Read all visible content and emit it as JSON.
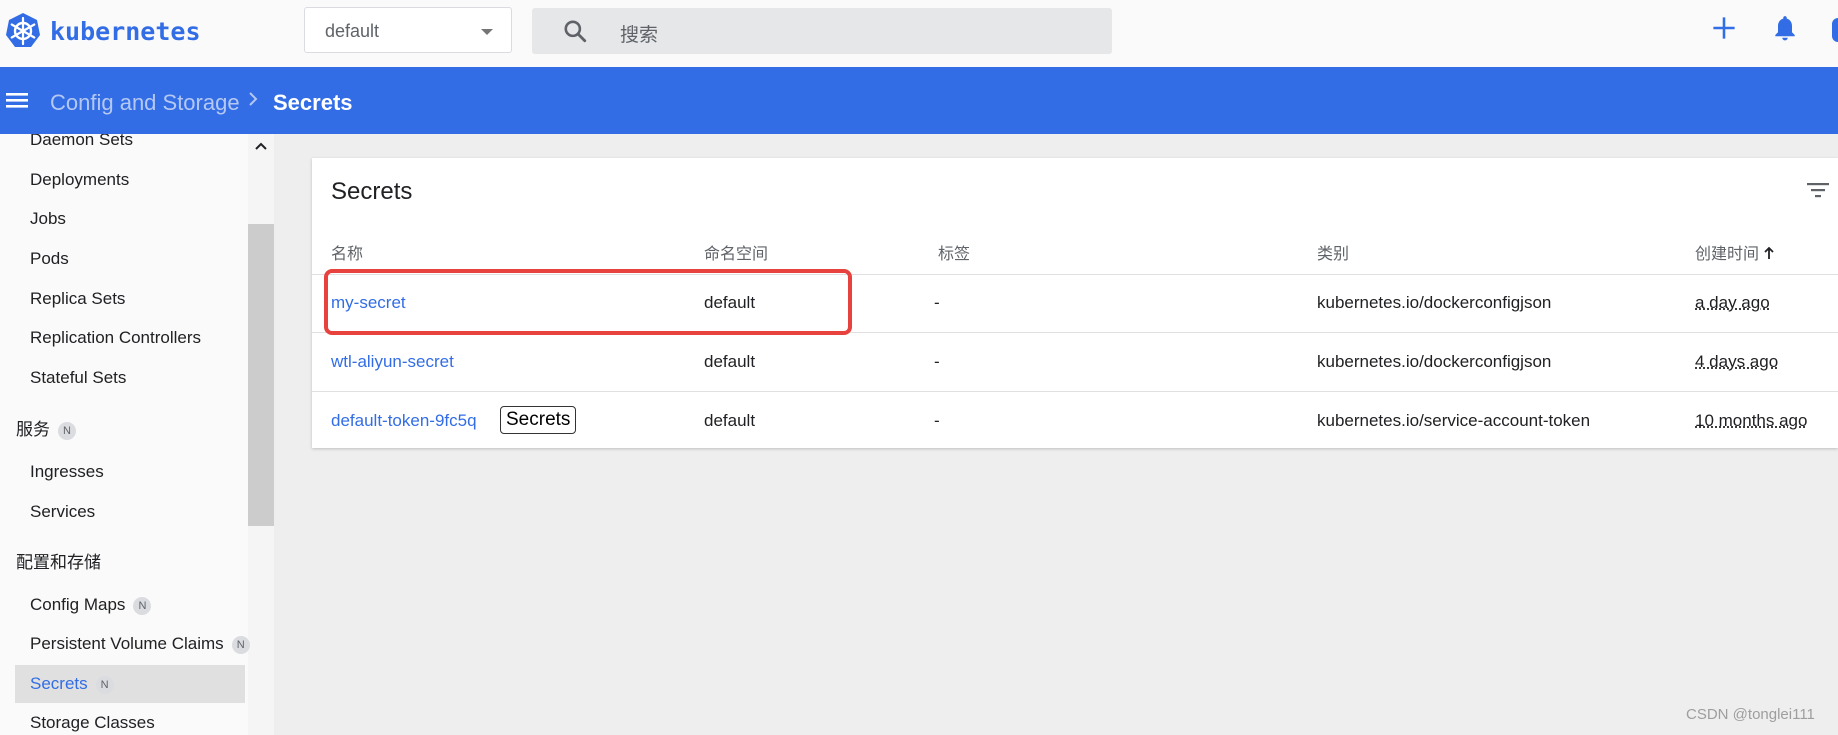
{
  "app": {
    "logo_text": "kubernetes"
  },
  "namespace": {
    "selected": "default"
  },
  "search": {
    "placeholder": "搜索"
  },
  "breadcrumb": {
    "parent": "Config and Storage",
    "current": "Secrets"
  },
  "sidebar": {
    "items_top": [
      "Daemon Sets",
      "Deployments",
      "Jobs",
      "Pods",
      "Replica Sets",
      "Replication Controllers",
      "Stateful Sets"
    ],
    "section_services": {
      "label": "服务",
      "badge": "N"
    },
    "items_services": [
      "Ingresses",
      "Services"
    ],
    "section_config": {
      "label": "配置和存储"
    },
    "config_items": [
      {
        "label": "Config Maps",
        "badge": "N"
      },
      {
        "label": "Persistent Volume Claims",
        "badge": "N"
      },
      {
        "label": "Secrets",
        "badge": "N"
      },
      {
        "label": "Storage Classes"
      }
    ]
  },
  "card": {
    "title": "Secrets"
  },
  "table": {
    "headers": [
      "名称",
      "命名空间",
      "标签",
      "类别",
      "创建时间"
    ],
    "rows": [
      {
        "name": "my-secret",
        "namespace": "default",
        "labels": "-",
        "type": "kubernetes.io/dockerconfigjson",
        "age": "a day ago"
      },
      {
        "name": "wtl-aliyun-secret",
        "namespace": "default",
        "labels": "-",
        "type": "kubernetes.io/dockerconfigjson",
        "age": "4 days ago"
      },
      {
        "name": "default-token-9fc5q",
        "namespace": "default",
        "labels": "-",
        "type": "kubernetes.io/service-account-token",
        "age": "10 months ago"
      }
    ]
  },
  "tooltip": {
    "text": "Secrets"
  },
  "watermark": "CSDN @tonglei111",
  "colors": {
    "primary": "#326de6",
    "highlight": "#e8423f"
  }
}
